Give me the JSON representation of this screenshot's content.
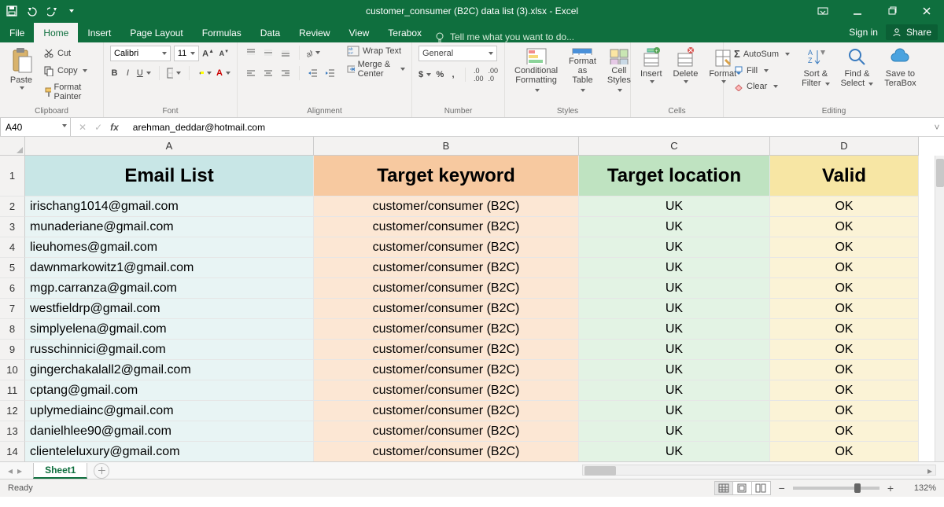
{
  "title": "customer_consumer (B2C) data list (3).xlsx - Excel",
  "tabs": {
    "file": "File",
    "home": "Home",
    "insert": "Insert",
    "page_layout": "Page Layout",
    "formulas": "Formulas",
    "data": "Data",
    "review": "Review",
    "view": "View",
    "terabox": "Terabox"
  },
  "tell_me": "Tell me what you want to do...",
  "sign_in": "Sign in",
  "share": "Share",
  "ribbon": {
    "clipboard": {
      "label": "Clipboard",
      "paste": "Paste",
      "cut": "Cut",
      "copy": "Copy",
      "format_painter": "Format Painter"
    },
    "font": {
      "label": "Font",
      "name": "Calibri",
      "size": "11"
    },
    "alignment": {
      "label": "Alignment",
      "wrap": "Wrap Text",
      "merge": "Merge & Center"
    },
    "number": {
      "label": "Number",
      "format": "General"
    },
    "styles": {
      "label": "Styles",
      "cond": "Conditional",
      "cond2": "Formatting",
      "fat": "Format as",
      "fat2": "Table",
      "cs": "Cell",
      "cs2": "Styles"
    },
    "cells": {
      "label": "Cells",
      "insert": "Insert",
      "delete": "Delete",
      "format": "Format"
    },
    "editing": {
      "label": "Editing",
      "autosum": "AutoSum",
      "fill": "Fill",
      "clear": "Clear",
      "sort": "Sort &",
      "sort2": "Filter",
      "find": "Find &",
      "find2": "Select",
      "save": "Save to",
      "save2": "TeraBox"
    }
  },
  "name_box": "A40",
  "formula": "arehman_deddar@hotmail.com",
  "columns": [
    "A",
    "B",
    "C",
    "D"
  ],
  "headers": {
    "A": "Email List",
    "B": "Target keyword",
    "C": "Target location",
    "D": "Valid"
  },
  "rows": [
    {
      "n": "2",
      "A": "irischang1014@gmail.com",
      "B": "customer/consumer (B2C)",
      "C": "UK",
      "D": "OK"
    },
    {
      "n": "3",
      "A": "munaderiane@gmail.com",
      "B": "customer/consumer (B2C)",
      "C": "UK",
      "D": "OK"
    },
    {
      "n": "4",
      "A": "lieuhomes@gmail.com",
      "B": "customer/consumer (B2C)",
      "C": "UK",
      "D": "OK"
    },
    {
      "n": "5",
      "A": "dawnmarkowitz1@gmail.com",
      "B": "customer/consumer (B2C)",
      "C": "UK",
      "D": "OK"
    },
    {
      "n": "6",
      "A": "mgp.carranza@gmail.com",
      "B": "customer/consumer (B2C)",
      "C": "UK",
      "D": "OK"
    },
    {
      "n": "7",
      "A": "westfieldrp@gmail.com",
      "B": "customer/consumer (B2C)",
      "C": "UK",
      "D": "OK"
    },
    {
      "n": "8",
      "A": "simplyelena@gmail.com",
      "B": "customer/consumer (B2C)",
      "C": "UK",
      "D": "OK"
    },
    {
      "n": "9",
      "A": "russchinnici@gmail.com",
      "B": "customer/consumer (B2C)",
      "C": "UK",
      "D": "OK"
    },
    {
      "n": "10",
      "A": "gingerchakalall2@gmail.com",
      "B": "customer/consumer (B2C)",
      "C": "UK",
      "D": "OK"
    },
    {
      "n": "11",
      "A": "cptang@gmail.com",
      "B": "customer/consumer (B2C)",
      "C": "UK",
      "D": "OK"
    },
    {
      "n": "12",
      "A": "uplymediainc@gmail.com",
      "B": "customer/consumer (B2C)",
      "C": "UK",
      "D": "OK"
    },
    {
      "n": "13",
      "A": "danielhlee90@gmail.com",
      "B": "customer/consumer (B2C)",
      "C": "UK",
      "D": "OK"
    },
    {
      "n": "14",
      "A": "clienteleluxury@gmail.com",
      "B": "customer/consumer (B2C)",
      "C": "UK",
      "D": "OK"
    }
  ],
  "sheet_tab": "Sheet1",
  "status_ready": "Ready",
  "zoom": "132%"
}
